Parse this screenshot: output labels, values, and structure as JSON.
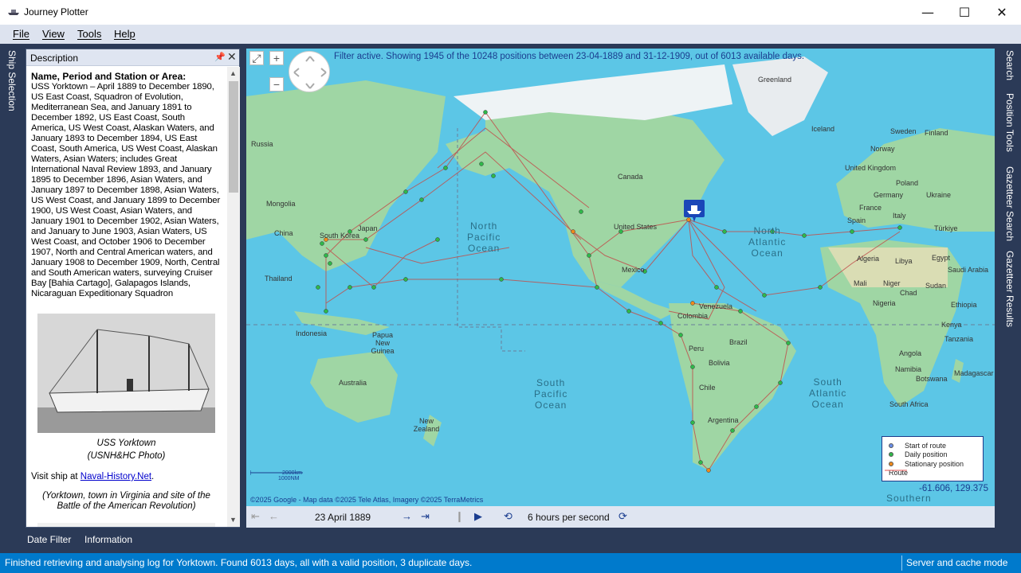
{
  "window": {
    "title": "Journey Plotter",
    "minimize": "—",
    "maximize": "☐",
    "close": "✕"
  },
  "menu": [
    "File",
    "View",
    "Tools",
    "Help"
  ],
  "left_tabs": {
    "ship_selection": "Ship Selection"
  },
  "right_tabs": [
    "Search",
    "Position Tools",
    "Gazetteer Search",
    "Gazetteer Results"
  ],
  "description": {
    "header": "Description",
    "heading": "Name, Period and Station or Area:",
    "body": "USS Yorktown – April 1889 to December 1890, US East Coast, Squadron of Evolution, Mediterranean Sea, and January 1891 to December 1892, US East Coast, South America, US West Coast, Alaskan Waters, and January 1893 to December 1894, US East Coast, South America, US West Coast, Alaskan Waters, Asian Waters; includes Great International Naval Review 1893, and January 1895 to December 1896, Asian Waters, and January 1897 to December 1898, Asian Waters, US West Coast, and January 1899 to December 1900, US West Coast, Asian Waters, and January 1901 to December 1902, Asian Waters, and January to June 1903, Asian Waters, US West Coast, and October 1906 to December 1907, North and Central American waters, and January 1908 to December 1909, North, Central and South American waters, surveying Cruiser Bay [Bahia Cartago], Galapagos Islands, Nicaraguan Expeditionary Squadron",
    "caption_line1": "USS Yorktown",
    "caption_line2": "(USNH&HC Photo)",
    "visit_prefix": "Visit ship at ",
    "visit_link": "Naval-History.Net",
    "visit_suffix": ".",
    "town_note": "(Yorktown, town in Virginia and site of the Battle of the American Revolution)"
  },
  "map": {
    "filter_text": "Filter active. Showing 1945 of the 10248 positions between 23-04-1889 and 31-12-1909, out of 6013 available days.",
    "labels": {
      "greenland": "Greenland",
      "iceland": "Iceland",
      "sweden": "Sweden",
      "norway": "Norway",
      "finland": "Finland",
      "russia": "Russia",
      "uk": "United Kingdom",
      "poland": "Poland",
      "germany": "Germany",
      "ukraine": "Ukraine",
      "france": "France",
      "spain": "Spain",
      "italy": "Italy",
      "turkiye": "Türkiye",
      "algeria": "Algeria",
      "libya": "Libya",
      "egypt": "Egypt",
      "saudi": "Saudi Arabia",
      "mali": "Mali",
      "niger": "Niger",
      "chad": "Chad",
      "sudan": "Sudan",
      "ethiopia": "Ethiopia",
      "nigeria": "Nigeria",
      "kenya": "Kenya",
      "tanzania": "Tanzania",
      "angola": "Angola",
      "namibia": "Namibia",
      "botswana": "Botswana",
      "madagascar": "Madagascar",
      "southafrica": "South Africa",
      "canada": "Canada",
      "us": "United States",
      "mexico": "Mexico",
      "venezuela": "Venezuela",
      "colombia": "Colombia",
      "peru": "Peru",
      "bolivia": "Bolivia",
      "brazil": "Brazil",
      "chile": "Chile",
      "argentina": "Argentina",
      "mongolia": "Mongolia",
      "china": "China",
      "korea": "South Korea",
      "japan": "Japan",
      "thailand": "Thailand",
      "indonesia": "Indonesia",
      "png": "Papua New Guinea",
      "australia": "Australia",
      "nz": "New Zealand",
      "southern": "Southern"
    },
    "oceans": {
      "npacific": "North\nPacific\nOcean",
      "natlantic": "North\nAtlantic\nOcean",
      "spacific": "South\nPacific\nOcean",
      "satlantic": "South\nAtlantic\nOcean"
    },
    "legend": {
      "start": "Start of route",
      "daily": "Daily position",
      "stationary": "Stationary position",
      "route": "Route",
      "start_color": "#6a8ee8",
      "daily_color": "#2fb84a",
      "stationary_color": "#f08a1c",
      "route_color": "#e05050"
    },
    "coords": "-61.606, 129.375",
    "copyright": "©2025 Google - Map data ©2025 Tele Atlas, Imagery ©2025 TerraMetrics",
    "scale_top": "2000km",
    "scale_bottom": "1000NM",
    "zoom_in": "+",
    "zoom_out": "−"
  },
  "playback": {
    "date": "23 April 1889",
    "speed": "6 hours per second"
  },
  "bottom_tabs": [
    "Date Filter",
    "Information"
  ],
  "status": {
    "message": "Finished retrieving and analysing log for Yorktown. Found 6013 days, all with a valid position, 3 duplicate days.",
    "mode": "Server and cache mode"
  }
}
